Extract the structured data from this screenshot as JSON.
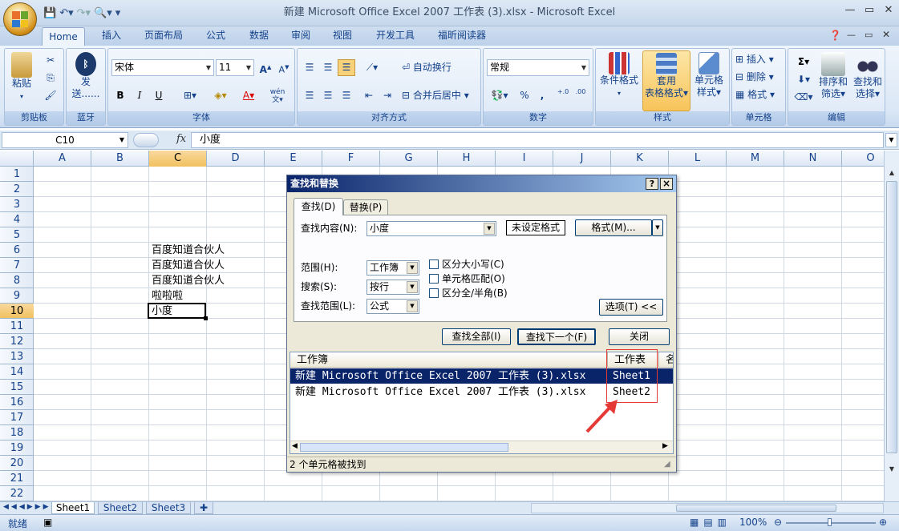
{
  "app": {
    "window_title": "新建 Microsoft Office Excel 2007 工作表 (3).xlsx - Microsoft Excel"
  },
  "ribbon_tabs": [
    "Home",
    "插入",
    "页面布局",
    "公式",
    "数据",
    "审阅",
    "视图",
    "开发工具",
    "福昕阅读器"
  ],
  "ribbon": {
    "clipboard": {
      "label": "剪贴板",
      "paste": "粘贴"
    },
    "bluetooth": {
      "label": "蓝牙",
      "send": "发",
      "send2": "送......"
    },
    "font": {
      "label": "字体",
      "name": "宋体",
      "size": "11",
      "bold": "B",
      "italic": "I",
      "underline": "U",
      "grow": "A",
      "shrink": "A",
      "font_color": "A",
      "phonetic": "wén"
    },
    "alignment": {
      "label": "对齐方式",
      "wrap": "自动换行",
      "merge": "合并后居中"
    },
    "number": {
      "label": "数字",
      "format": "常规",
      "percent": "%",
      "comma": ",",
      "inc": "+.0",
      "dec": ".00"
    },
    "styles": {
      "label": "样式",
      "cond": "条件格式",
      "table": "套用",
      "table2": "表格格式",
      "cell": "单元格",
      "cell2": "样式"
    },
    "cells": {
      "label": "单元格",
      "insert": "插入",
      "delete": "删除",
      "format": "格式"
    },
    "editing": {
      "label": "编辑",
      "sum": "Σ",
      "sort": "排序和",
      "sort2": "筛选",
      "find": "查找和",
      "find2": "选择"
    }
  },
  "formula_bar": {
    "name_box": "C10",
    "fx": "fx",
    "value": "小度"
  },
  "columns": [
    "A",
    "B",
    "C",
    "D",
    "E",
    "F",
    "G",
    "H",
    "I",
    "J",
    "K",
    "L",
    "M",
    "N",
    "O"
  ],
  "rows": [
    "1",
    "2",
    "3",
    "4",
    "5",
    "6",
    "7",
    "8",
    "9",
    "10",
    "11",
    "12",
    "13",
    "14",
    "15",
    "16",
    "17",
    "18",
    "19",
    "20",
    "21",
    "22"
  ],
  "cells": [
    {
      "ref": "C6",
      "value": "百度知道合伙人"
    },
    {
      "ref": "C7",
      "value": "百度知道合伙人"
    },
    {
      "ref": "C8",
      "value": "百度知道合伙人"
    },
    {
      "ref": "C9",
      "value": "啦啦啦"
    },
    {
      "ref": "C10",
      "value": "小度"
    }
  ],
  "sheets": [
    "Sheet1",
    "Sheet2",
    "Sheet3"
  ],
  "status": {
    "ready": "就绪",
    "zoom": "100%"
  },
  "dialog": {
    "title": "查找和替换",
    "help": "?",
    "close_x": "×",
    "tab_find": "查找(D)",
    "tab_replace": "替换(P)",
    "find_label": "查找内容(N):",
    "find_value": "小度",
    "no_format": "未设定格式",
    "format_btn": "格式(M)...",
    "scope_label": "范围(H):",
    "scope_value": "工作簿",
    "search_label": "搜索(S):",
    "search_value": "按行",
    "lookin_label": "查找范围(L):",
    "lookin_value": "公式",
    "match_case": "区分大小写(C)",
    "match_cell": "单元格匹配(O)",
    "match_width": "区分全/半角(B)",
    "options_btn": "选项(T) <<",
    "find_all": "查找全部(I)",
    "find_next": "查找下一个(F)",
    "close_btn": "关闭",
    "results_headers": [
      "工作簿",
      "工作表",
      "名"
    ],
    "results": [
      {
        "book": "新建 Microsoft Office Excel 2007 工作表 (3).xlsx",
        "sheet": "Sheet1"
      },
      {
        "book": "新建 Microsoft Office Excel 2007 工作表 (3).xlsx",
        "sheet": "Sheet2"
      }
    ],
    "status": "2 个单元格被找到"
  },
  "colors": {
    "highlight_box": "#e53935",
    "selected_row": "#0a246a"
  }
}
